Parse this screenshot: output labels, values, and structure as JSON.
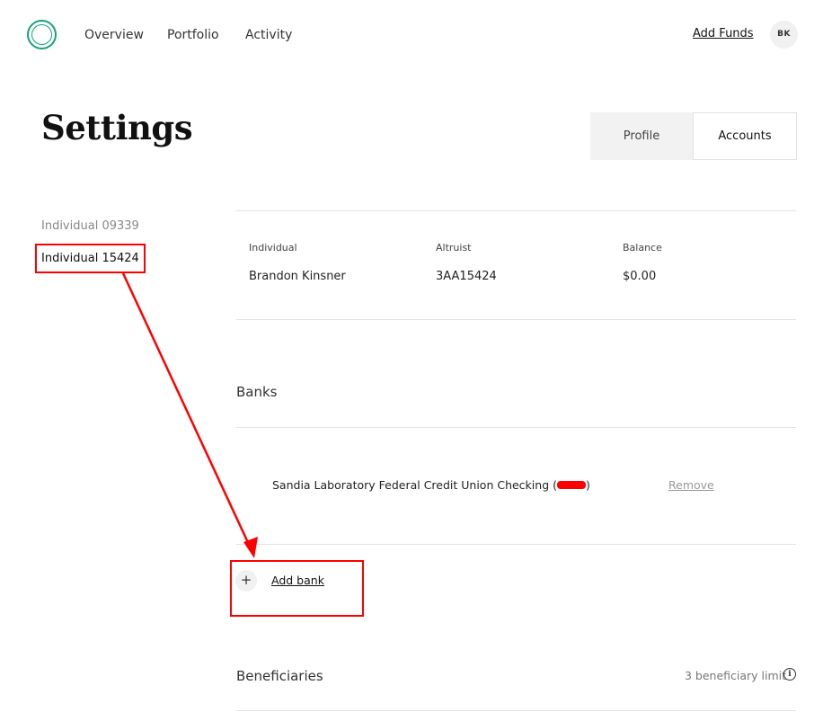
{
  "header": {
    "logo_icon": "ring-logo-icon",
    "nav": [
      "Overview",
      "Portfolio",
      "Activity"
    ],
    "add_funds": "Add Funds",
    "avatar_initials": "BK",
    "brand_color": "#12a37b"
  },
  "page": {
    "title": "Settings",
    "tabs": [
      {
        "label": "Profile",
        "active": false
      },
      {
        "label": "Accounts",
        "active": true
      }
    ]
  },
  "sidebar": {
    "items": [
      {
        "label": "Individual 09339",
        "selected": false
      },
      {
        "label": "Individual 15424",
        "selected": true
      }
    ]
  },
  "account": {
    "headers": [
      "Individual",
      "Altruist",
      "Balance"
    ],
    "values": [
      "Brandon Kinsner",
      "3AA15424",
      "$0.00"
    ]
  },
  "banks": {
    "title": "Banks",
    "items": [
      {
        "name": "Sandia Laboratory Federal Credit Union Checking (",
        "suffix": ")",
        "remove_label": "Remove"
      }
    ],
    "add_label": "Add bank",
    "add_icon": "plus-icon"
  },
  "beneficiaries": {
    "title": "Beneficiaries",
    "limit_text": "3 beneficiary limit",
    "info_icon": "info-icon"
  },
  "annotation": {
    "color": "#ff0000"
  }
}
